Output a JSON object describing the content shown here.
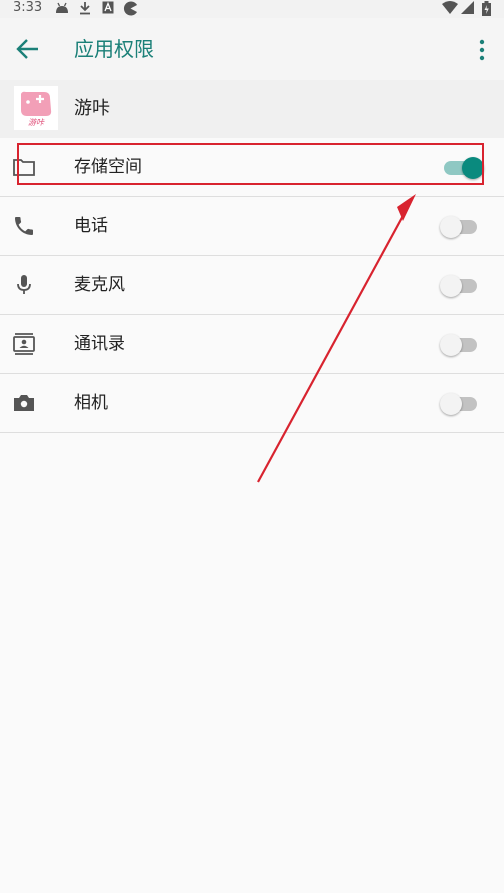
{
  "status_bar": {
    "time": "3:33"
  },
  "app_bar": {
    "title": "应用权限"
  },
  "app": {
    "name": "游咔",
    "icon_text": "游咔"
  },
  "permissions": [
    {
      "label": "存储空间",
      "icon": "folder-icon",
      "enabled": true
    },
    {
      "label": "电话",
      "icon": "phone-icon",
      "enabled": false
    },
    {
      "label": "麦克风",
      "icon": "microphone-icon",
      "enabled": false
    },
    {
      "label": "通讯录",
      "icon": "contacts-icon",
      "enabled": false
    },
    {
      "label": "相机",
      "icon": "camera-icon",
      "enabled": false
    }
  ],
  "colors": {
    "accent": "#1b8078",
    "toggle_on": "#0a8a7e",
    "annotation": "#d8232f"
  }
}
